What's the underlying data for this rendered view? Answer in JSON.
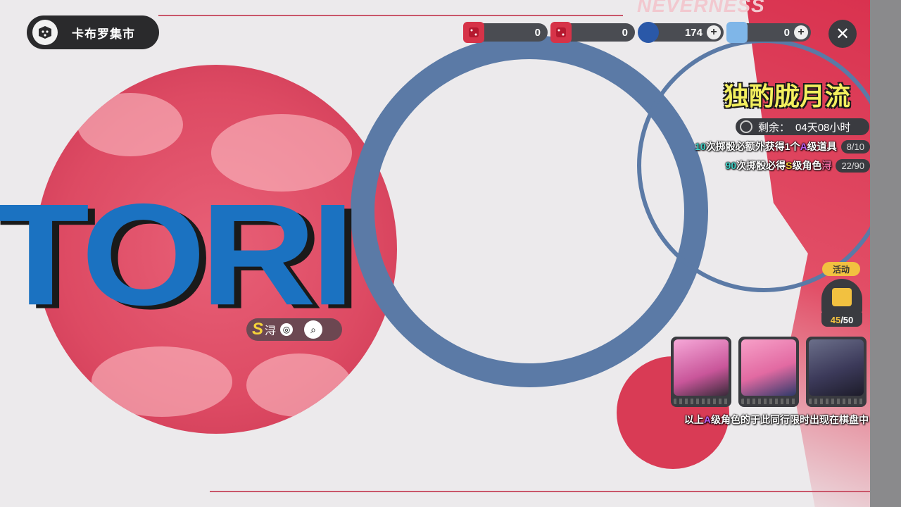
{
  "location": {
    "name": "卡布罗集市",
    "icon": "dice-icon"
  },
  "currencies": [
    {
      "icon": "red-dice-icon",
      "value": "0",
      "has_plus": false
    },
    {
      "icon": "red-dice-icon",
      "value": "0",
      "has_plus": false
    },
    {
      "icon": "blue-orb-icon",
      "value": "174",
      "has_plus": true
    },
    {
      "icon": "crystal-icon",
      "value": "0",
      "has_plus": true
    }
  ],
  "close_label": "✕",
  "watermark": "NEVERNESS",
  "event": {
    "title": "独酌胧月流",
    "timer_label": "剩余：",
    "timer_value": "04天08小时",
    "reward1": {
      "count": "10",
      "text_a": "次掷骰必额外获得1个",
      "grade": "A",
      "text_b": "级道具",
      "progress": "8/10"
    },
    "reward2": {
      "count": "90",
      "text_a": "次掷骰必得",
      "grade": "S",
      "text_b": "级角色",
      "char": "浔",
      "progress": "22/90"
    }
  },
  "banner_text": "TORI",
  "character_pill": {
    "grade": "S",
    "name": "浔"
  },
  "activity": {
    "label": "活动",
    "current": "45",
    "total": "/50"
  },
  "portrait_note": {
    "text_a": "以上",
    "grade": "A",
    "text_b": "级角色的于此同行限时出现在棋盘中"
  },
  "colors": {
    "accent_red": "#d93b55",
    "ring_blue": "#5b7aa6",
    "banner_blue": "#1b72c1",
    "gold": "#f2c140"
  }
}
